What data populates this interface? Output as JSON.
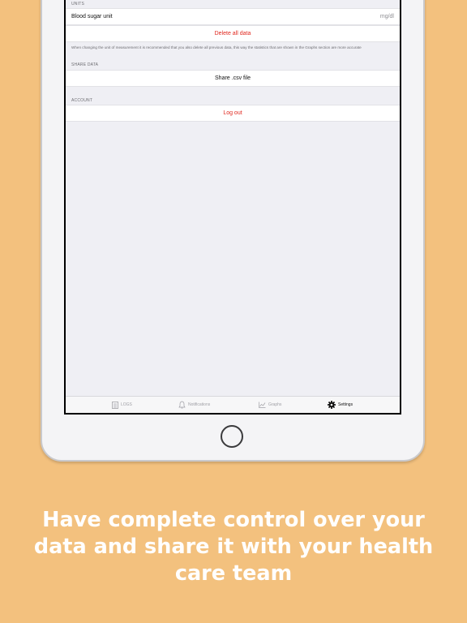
{
  "settings": {
    "units_header": "UNITS",
    "blood_sugar_label": "Blood sugar unit",
    "blood_sugar_value": "mg/dl",
    "delete_all_label": "Delete all data",
    "units_note": "When changing the unit of measurement it is recommended that you also delete all previous data, this way the statistics that are shown in the Graphs section are more accurate",
    "share_header": "SHARE DATA",
    "share_csv_label": "Share .csv file",
    "account_header": "ACCOUNT",
    "logout_label": "Log out"
  },
  "tabbar": {
    "items": [
      {
        "label": "LOGS",
        "icon": "logs-icon"
      },
      {
        "label": "Notifications",
        "icon": "bell-icon"
      },
      {
        "label": "Graphs",
        "icon": "graph-icon"
      },
      {
        "label": "Settings",
        "icon": "gear-icon",
        "active": true
      }
    ]
  },
  "caption": "Have complete control over your data and share it with your health care team",
  "colors": {
    "background": "#f3c17e",
    "destructive": "#e0281f",
    "caption_text": "#ffffff"
  }
}
